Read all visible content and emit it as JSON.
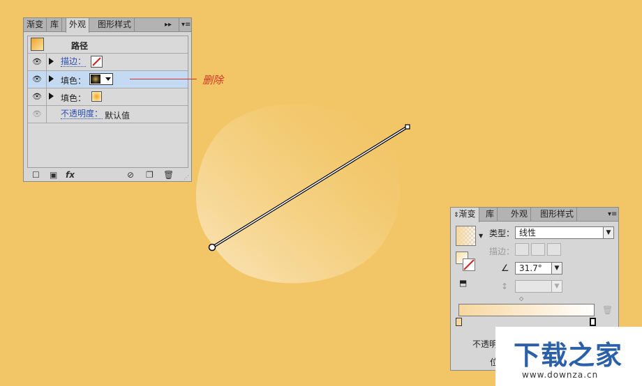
{
  "appearance_panel": {
    "tabs": [
      "渐变",
      "库",
      "外观",
      "图形样式"
    ],
    "active_tab": "外观",
    "menu_glyph": "▸▸",
    "header": {
      "title": "路径"
    },
    "rows": [
      {
        "label": "描边：",
        "kind": "stroke"
      },
      {
        "label": "填色：",
        "kind": "fill-radial-dark",
        "selected": true
      },
      {
        "label": "填色：",
        "kind": "fill-radial-light"
      },
      {
        "label": "不透明度：",
        "value": "默认值"
      }
    ],
    "footer_icons": [
      "new-stroke-icon",
      "new-fill-icon",
      "fx-icon",
      "clear-icon",
      "duplicate-icon",
      "delete-icon"
    ],
    "fx_label": "fx"
  },
  "annotation": {
    "text": "删除",
    "color": "#d23a2a"
  },
  "gradient_panel": {
    "tabs": [
      "渐变",
      "库",
      "外观",
      "图形样式"
    ],
    "active_tab": "渐变",
    "type_label": "类型：",
    "type_value": "线性",
    "stroke_label": "描边：",
    "angle_value": "31.7°",
    "opacity_label": "不透明",
    "location_label": "位"
  },
  "watermark": {
    "title": "下载之家",
    "url": "www.downza.cn"
  },
  "colors": {
    "background": "#f2c566",
    "panel": "#d6d6d6",
    "selection": "#c4d9f2",
    "accent_red": "#d23a2a"
  }
}
